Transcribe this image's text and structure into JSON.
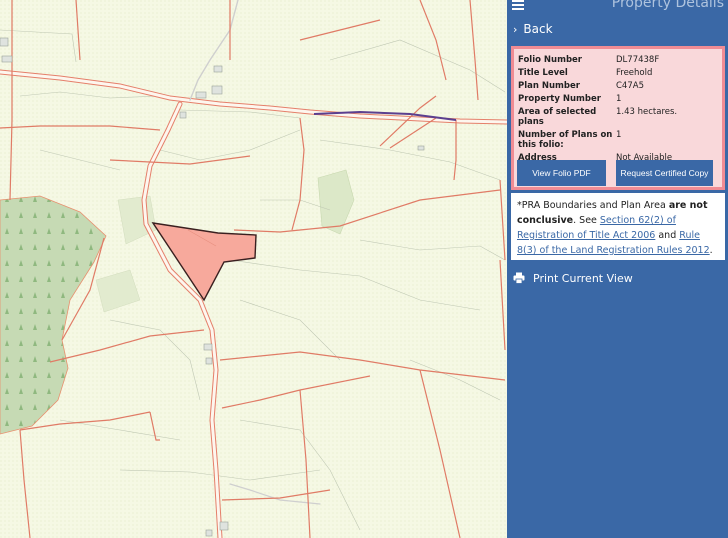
{
  "panel": {
    "title": "Property Details",
    "back_label": "Back",
    "print_label": "Print Current View"
  },
  "details": [
    {
      "label": "Folio Number",
      "value": "DL77438F"
    },
    {
      "label": "Title Level",
      "value": "Freehold"
    },
    {
      "label": "Plan Number",
      "value": "C47A5"
    },
    {
      "label": "Property Number",
      "value": "1"
    },
    {
      "label": "Area of selected plans",
      "value": "1.43 hectares."
    },
    {
      "label": "Number of Plans on this folio:",
      "value": "1"
    },
    {
      "label": "Address",
      "value": "Not Available"
    }
  ],
  "buttons": {
    "view_pdf": "View Folio PDF",
    "request_copy": "Request Certified Copy"
  },
  "notice": {
    "prefix": "*PRA Boundaries and Plan Area ",
    "bold": "are not conclusive",
    "mid": ". See ",
    "link1": "Section 62(2) of Registration of Title Act 2006",
    "and": " and ",
    "link2": "Rule 8(3) of the Land Registration Rules 2012",
    "suffix": "."
  },
  "colors": {
    "panel_bg": "#3a68a6",
    "card_bg": "#f9d8da",
    "card_border": "#f08c94",
    "parcel_fill": "#f7a99c",
    "boundary": "#e07b66",
    "forest": "#c5d9b2"
  }
}
